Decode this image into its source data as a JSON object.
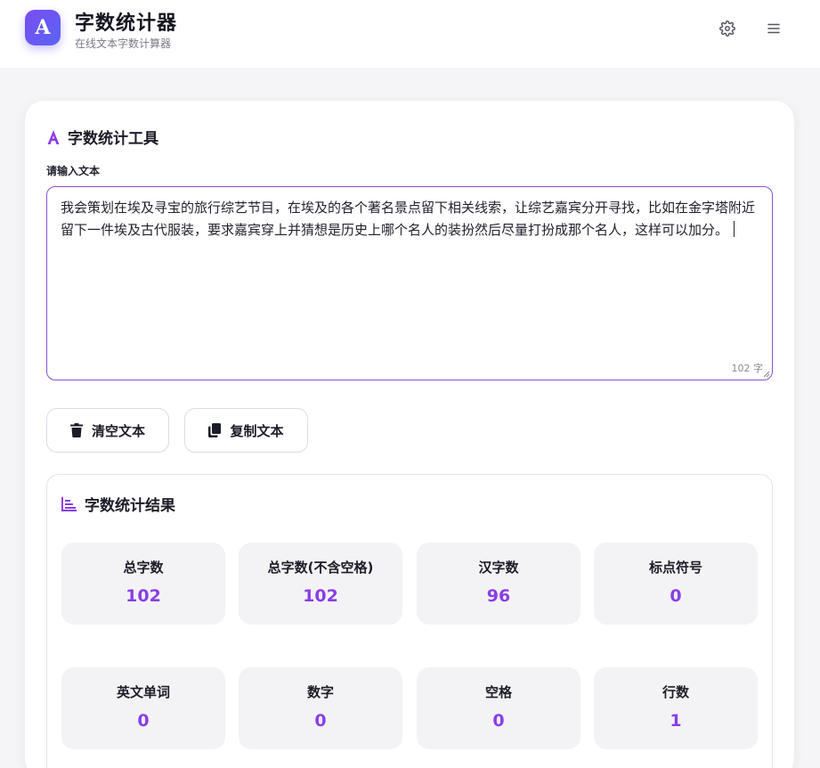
{
  "header": {
    "logo_letter": "A",
    "title": "字数统计器",
    "subtitle": "在线文本字数计算器",
    "settings_icon": "gear-icon",
    "menu_icon": "hamburger-menu-icon"
  },
  "tool": {
    "title": "字数统计工具",
    "title_icon": "font-a-icon",
    "input_label": "请输入文本",
    "text": "我会策划在埃及寻宝的旅行综艺节目，在埃及的各个著名景点留下相关线索，让综艺嘉宾分开寻找，比如在金字塔附近留下一件埃及古代服装，要求嘉宾穿上并猜想是历史上哪个名人的装扮然后尽量打扮成那个名人，这样可以加分。",
    "char_count": "102 字",
    "clear_button": "清空文本",
    "clear_icon": "trash-icon",
    "copy_button": "复制文本",
    "copy_icon": "copy-icon"
  },
  "results": {
    "title": "字数统计结果",
    "title_icon": "bar-chart-icon",
    "stats": [
      {
        "label": "总字数",
        "value": "102"
      },
      {
        "label": "总字数(不含空格)",
        "value": "102"
      },
      {
        "label": "汉字数",
        "value": "96"
      },
      {
        "label": "标点符号",
        "value": "0"
      },
      {
        "label": "英文单词",
        "value": "0"
      },
      {
        "label": "数字",
        "value": "0"
      },
      {
        "label": "空格",
        "value": "0"
      },
      {
        "label": "行数",
        "value": "1"
      }
    ]
  },
  "colors": {
    "accent": "#8a3ee6",
    "logo_gradient_start": "#7a4df0",
    "logo_gradient_end": "#5a63f5",
    "textarea_border": "#8b4fd6"
  }
}
